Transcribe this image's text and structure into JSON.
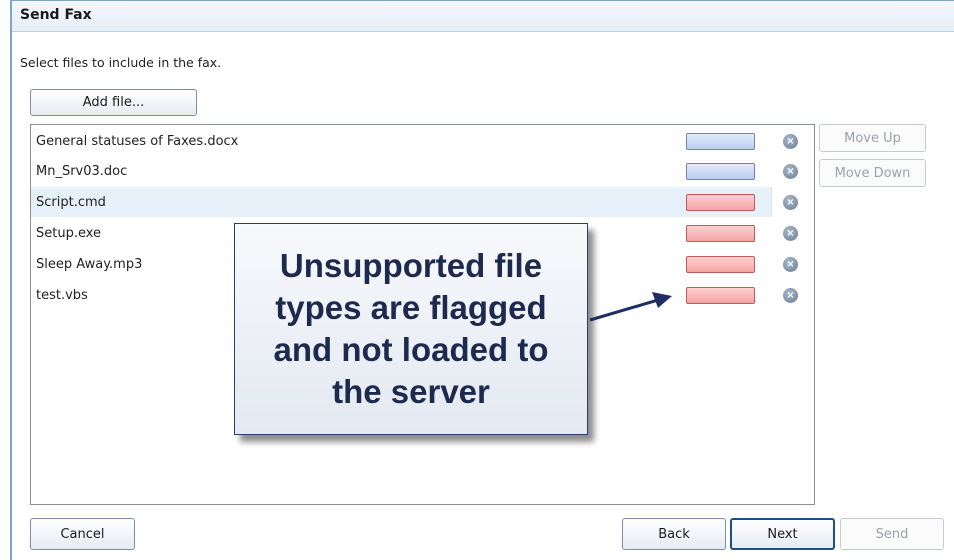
{
  "window": {
    "title": "Send Fax"
  },
  "instruction": "Select files to include in the fax.",
  "buttons": {
    "add_file": "Add file...",
    "move_up": "Move Up",
    "move_down": "Move Down",
    "cancel": "Cancel",
    "back": "Back",
    "next": "Next",
    "send": "Send"
  },
  "files": [
    {
      "name": "General statuses of Faxes.docx",
      "status": "supported"
    },
    {
      "name": "Mn_Srv03.doc",
      "status": "supported"
    },
    {
      "name": "Script.cmd",
      "status": "unsupported",
      "selected": true
    },
    {
      "name": "Setup.exe",
      "status": "unsupported"
    },
    {
      "name": "Sleep Away.mp3",
      "status": "unsupported"
    },
    {
      "name": "test.vbs",
      "status": "unsupported"
    }
  ],
  "callout": {
    "lines": [
      "Unsupported file",
      "types are flagged",
      "and not loaded to",
      "the server"
    ]
  },
  "colors": {
    "supported_bar": "#bccdf0",
    "unsupported_bar": "#f3a3a3",
    "selected_row": "#e6f0f8",
    "callout_text": "#1d2a4d",
    "arrow": "#1f2f66"
  },
  "icons": {
    "remove": "remove-circle-x-icon"
  }
}
